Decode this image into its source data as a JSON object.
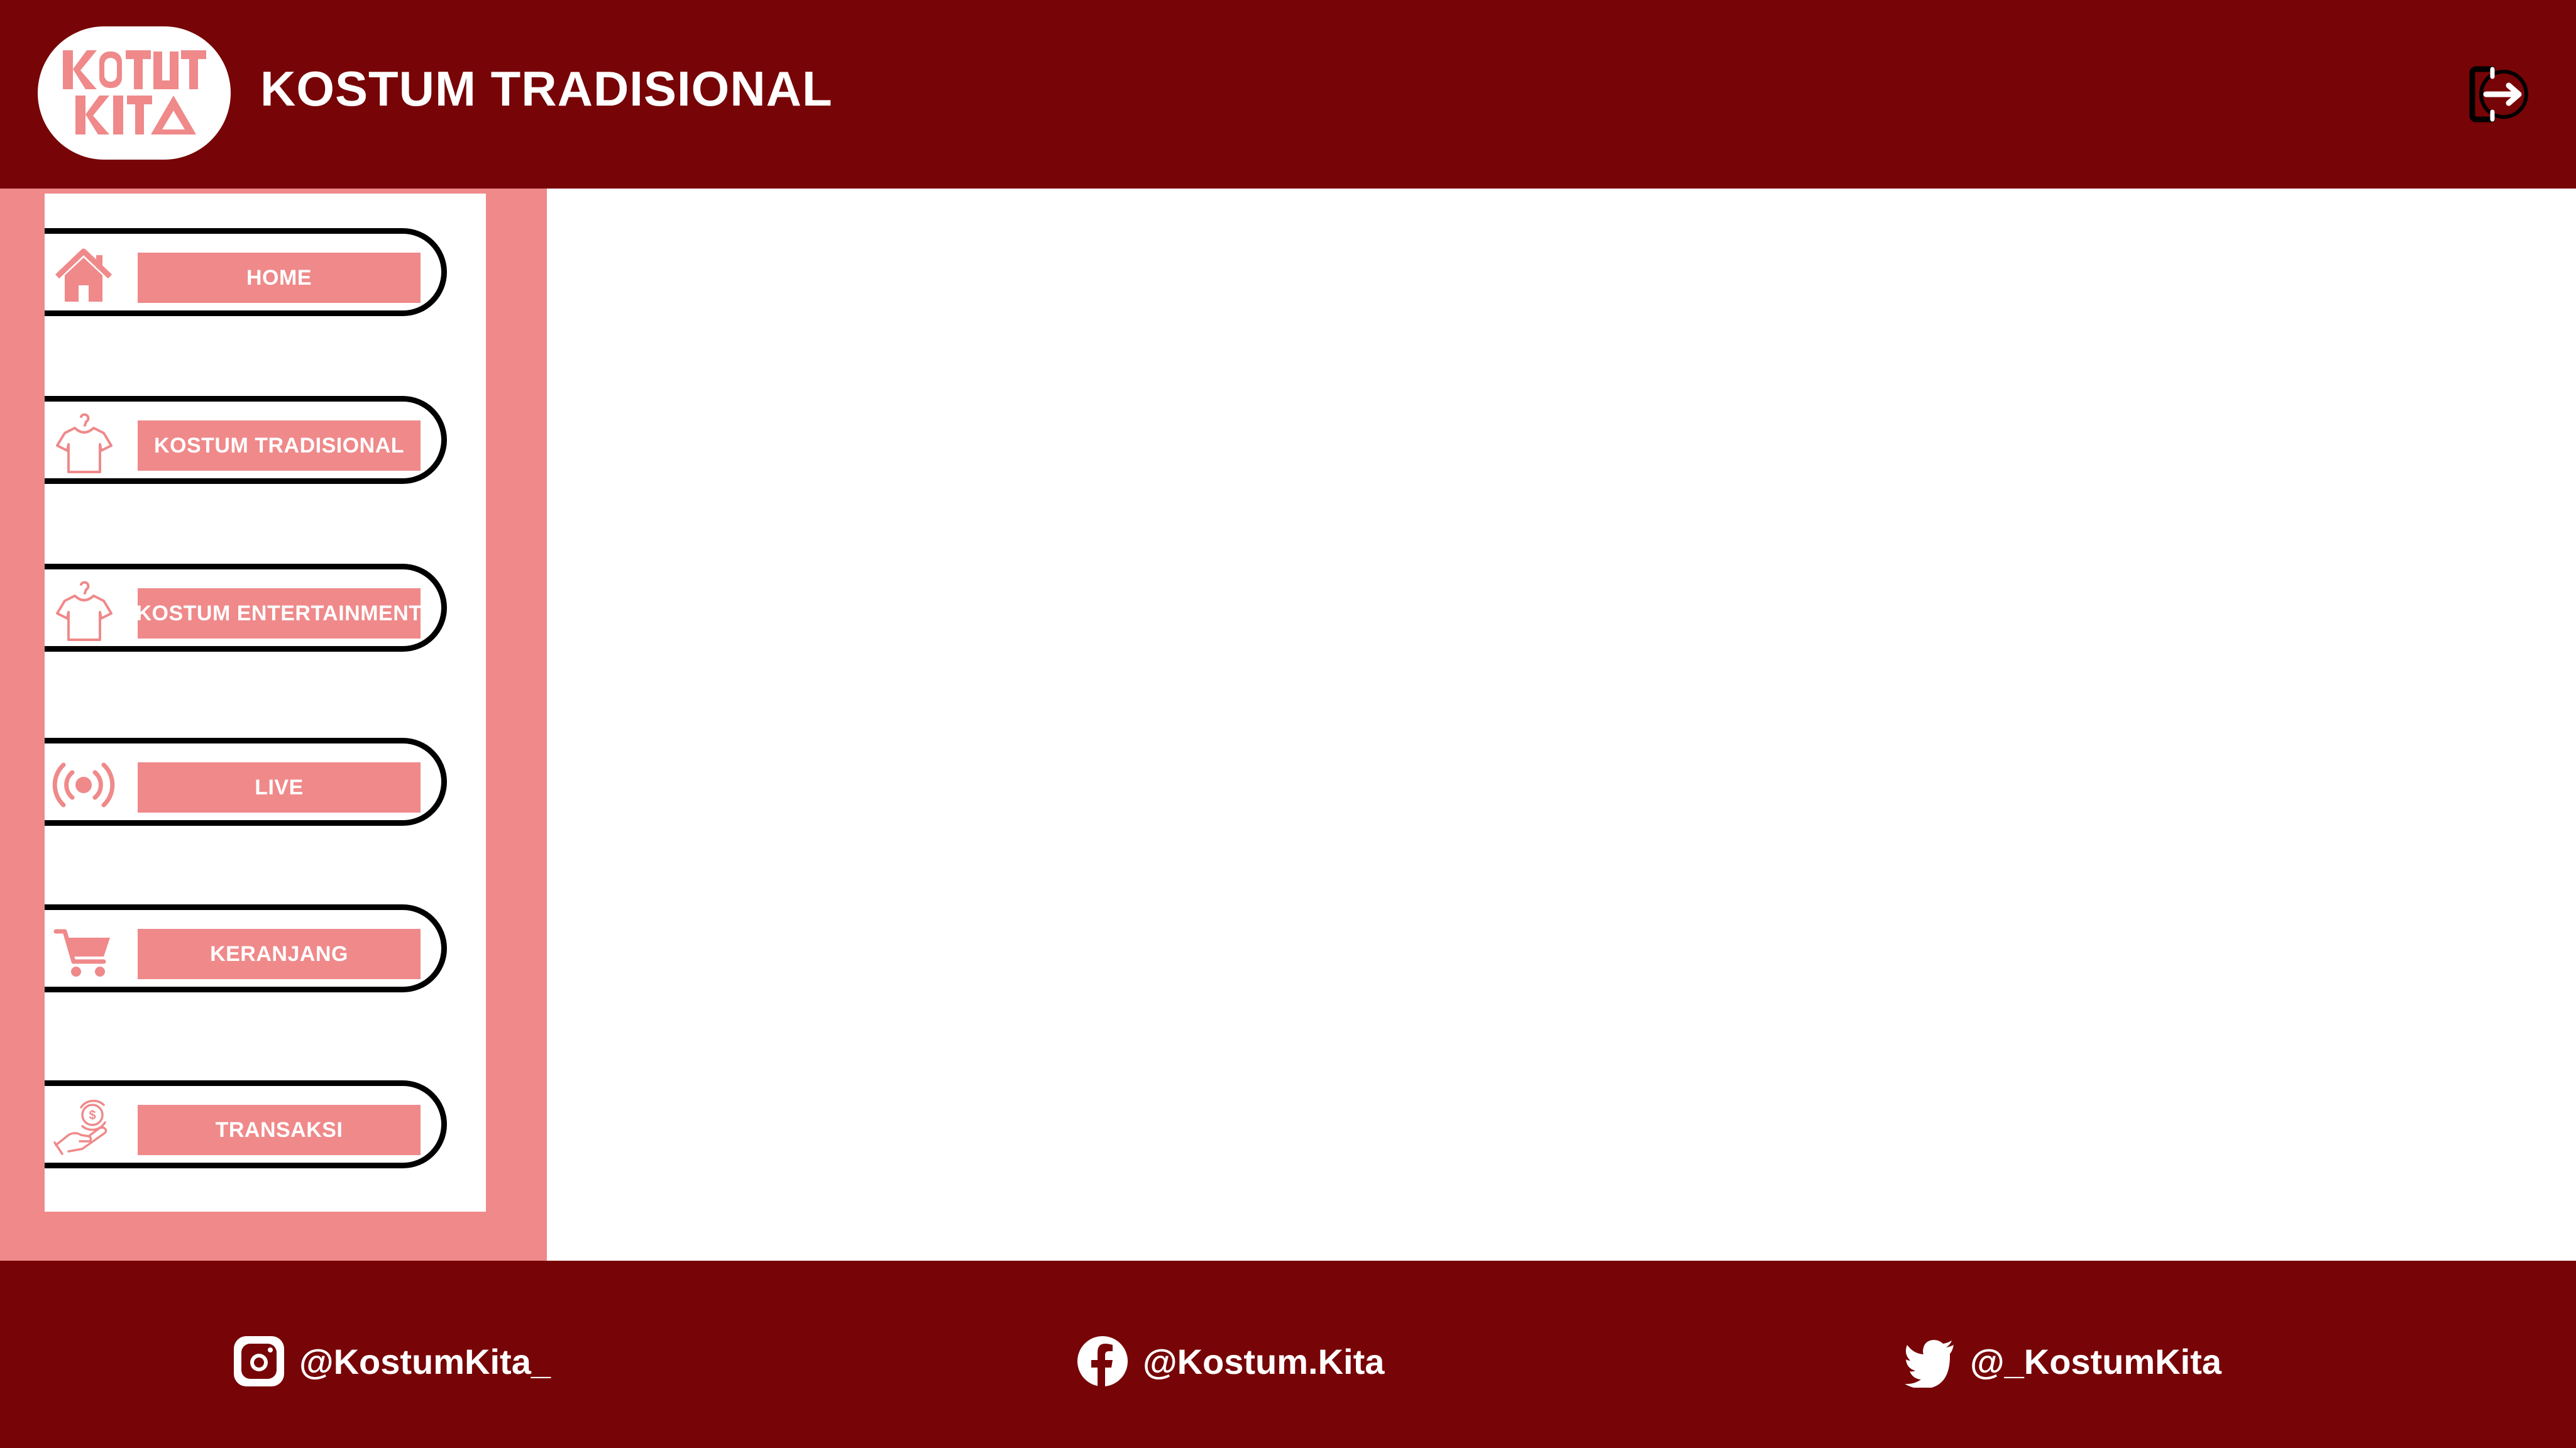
{
  "header": {
    "logo_text": [
      "KOSTUM",
      "KITA"
    ],
    "title": "KOSTUM TRADISIONAL",
    "logout_icon": "logout-icon"
  },
  "sidebar": {
    "items": [
      {
        "label": "HOME",
        "icon": "home-icon"
      },
      {
        "label": "KOSTUM TRADISIONAL",
        "icon": "shirt-hanger-icon"
      },
      {
        "label": "KOSTUM ENTERTAINMENT",
        "icon": "shirt-hanger-icon"
      },
      {
        "label": "LIVE",
        "icon": "live-broadcast-icon"
      },
      {
        "label": "KERANJANG",
        "icon": "cart-icon"
      },
      {
        "label": "TRANSAKSI",
        "icon": "money-hand-icon"
      }
    ]
  },
  "footer": {
    "instagram": "@KostumKita_",
    "facebook": "@Kostum.Kita",
    "twitter": "@_KostumKita"
  },
  "colors": {
    "brand_dark": "#770406",
    "accent_pink": "#ef898a",
    "white": "#ffffff"
  }
}
